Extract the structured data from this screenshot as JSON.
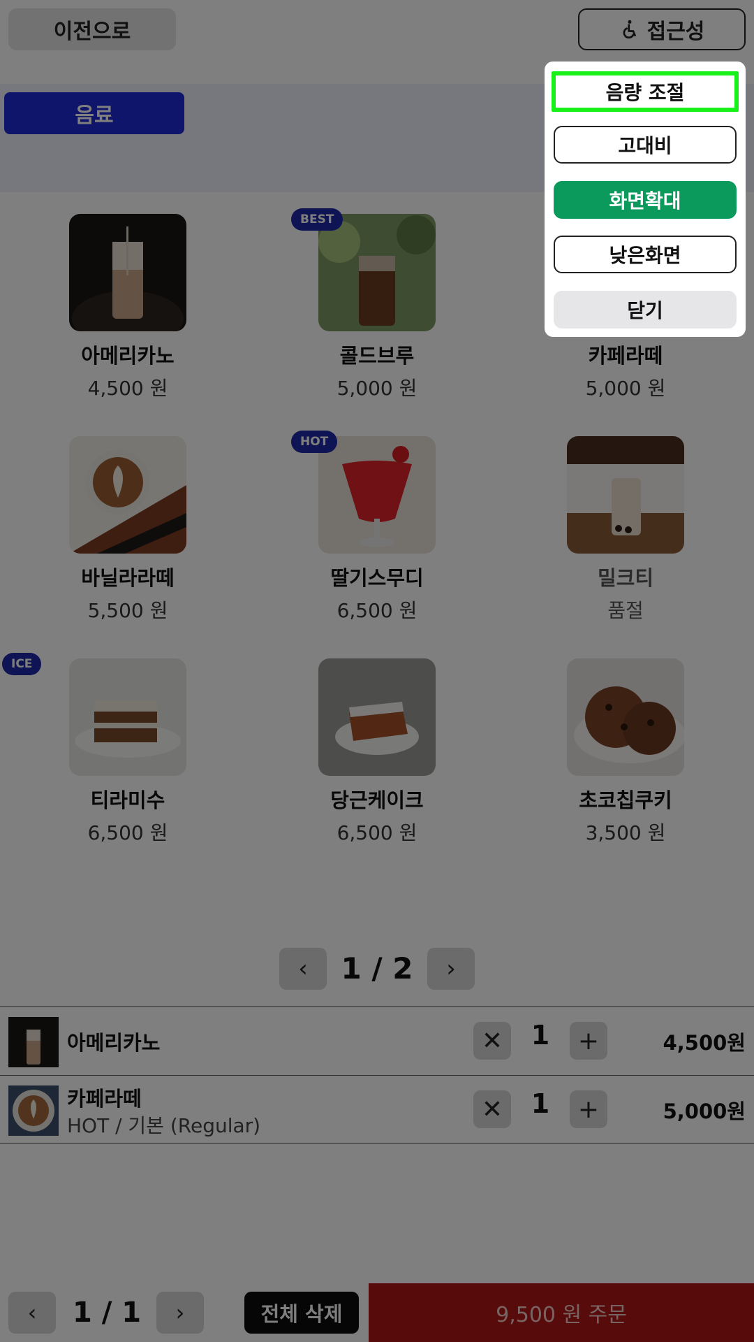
{
  "header": {
    "back_label": "이전으로",
    "accessibility_label": "접근성"
  },
  "category": {
    "active_tab": "음료"
  },
  "menu": {
    "items": [
      {
        "name": "아메리카노",
        "price": "4,500 원",
        "badge": "",
        "icon": "iced-coffee-photo"
      },
      {
        "name": "콜드브루",
        "price": "5,000 원",
        "badge": "BEST",
        "icon": "cold-brew-photo"
      },
      {
        "name": "카페라떼",
        "price": "5,000 원",
        "badge": "",
        "icon": "latte-photo"
      },
      {
        "name": "바닐라라떼",
        "price": "5,500 원",
        "badge": "",
        "icon": "latte-art-photo"
      },
      {
        "name": "딸기스무디",
        "price": "6,500 원",
        "badge": "HOT",
        "icon": "strawberry-smoothie-photo"
      },
      {
        "name": "밀크티",
        "price": "품절",
        "badge": "",
        "icon": "milk-tea-photo"
      },
      {
        "name": "티라미수",
        "price": "6,500 원",
        "badge": "ICE",
        "icon": "tiramisu-photo"
      },
      {
        "name": "당근케이크",
        "price": "6,500 원",
        "badge": "",
        "icon": "carrot-cake-photo"
      },
      {
        "name": "초코칩쿠키",
        "price": "3,500 원",
        "badge": "",
        "icon": "cookie-photo"
      }
    ],
    "pager": {
      "label": "1 / 2",
      "prev_icon": "chevron-left-icon",
      "next_icon": "chevron-right-icon"
    }
  },
  "cart": {
    "rows": [
      {
        "name": "아메리카노",
        "option": "",
        "qty": "1",
        "price": "4,500원",
        "icon": "iced-coffee-photo"
      },
      {
        "name": "카페라떼",
        "option": "HOT / 기본 (Regular)",
        "qty": "1",
        "price": "5,000원",
        "icon": "latte-art-photo"
      }
    ]
  },
  "footer": {
    "pager_label": "1 / 1",
    "clear_label": "전체 삭제",
    "order_label": "9,500 원 주문"
  },
  "accessibility_menu": {
    "volume_label": "음량 조절",
    "contrast_label": "고대비",
    "zoom_label": "화면확대",
    "low_screen_label": "낮은화면",
    "close_label": "닫기"
  },
  "colors": {
    "category_active": "#1c2bd6",
    "badge": "#1e2aa8",
    "order_button": "#b01717",
    "zoom_active": "#0b9a5b",
    "focus_ring": "#19ef19"
  }
}
